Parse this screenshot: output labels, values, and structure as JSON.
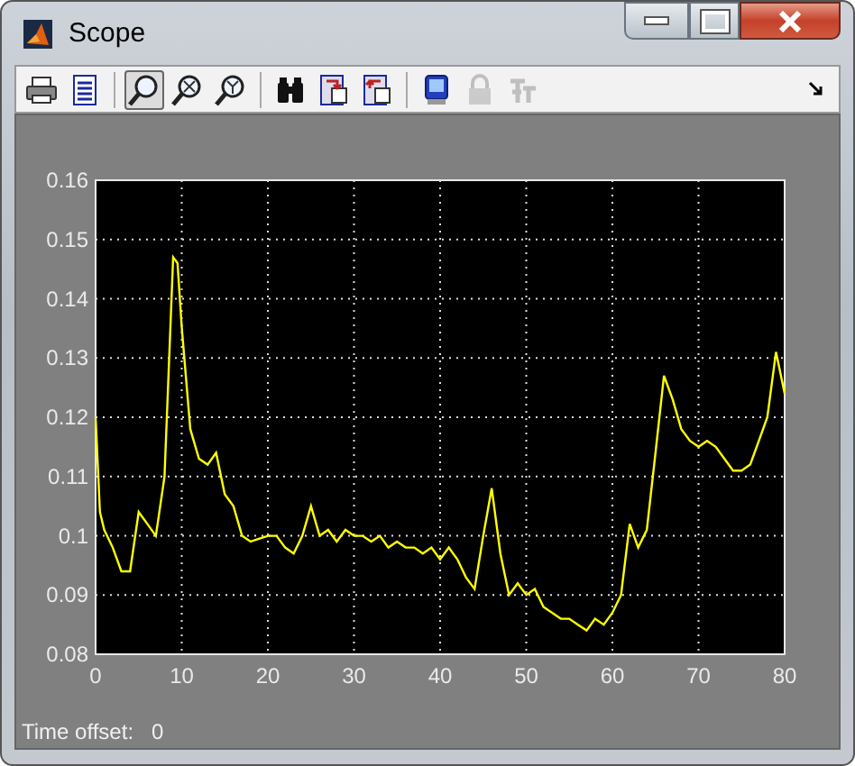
{
  "window": {
    "title": "Scope"
  },
  "toolbar": {
    "groups": [
      [
        {
          "kind": "print",
          "selected": false,
          "disabled": false
        },
        {
          "kind": "parameters",
          "selected": false,
          "disabled": false
        }
      ],
      [
        {
          "kind": "zoom",
          "selected": true,
          "disabled": false
        },
        {
          "kind": "zoom-x",
          "selected": false,
          "disabled": false
        },
        {
          "kind": "zoom-y",
          "selected": false,
          "disabled": false
        }
      ],
      [
        {
          "kind": "autoscale",
          "selected": false,
          "disabled": false
        },
        {
          "kind": "save-axes",
          "selected": false,
          "disabled": false
        },
        {
          "kind": "restore-axes",
          "selected": false,
          "disabled": false
        }
      ],
      [
        {
          "kind": "floating",
          "selected": false,
          "disabled": false
        },
        {
          "kind": "lock",
          "selected": false,
          "disabled": true
        },
        {
          "kind": "signal-selection",
          "selected": false,
          "disabled": true
        }
      ]
    ]
  },
  "scope": {
    "chart_data": {
      "type": "line",
      "x": [
        0,
        0.5,
        1,
        2,
        3,
        4,
        5,
        6,
        7,
        8,
        9,
        9.5,
        10,
        11,
        12,
        13,
        14,
        15,
        16,
        17,
        18,
        20,
        21,
        22,
        23,
        24,
        25,
        26,
        27,
        28,
        29,
        30,
        31,
        32,
        33,
        34,
        35,
        36,
        37,
        38,
        39,
        40,
        41,
        42,
        43,
        44,
        45,
        46,
        47,
        48,
        49,
        50,
        51,
        52,
        53,
        54,
        55,
        56,
        57,
        58,
        59,
        60,
        61,
        62,
        63,
        64,
        65,
        66,
        67,
        68,
        69,
        70,
        71,
        72,
        73,
        74,
        75,
        76,
        77,
        78,
        79,
        80
      ],
      "series": [
        {
          "color": "#ffff00",
          "values": [
            0.12,
            0.104,
            0.101,
            0.098,
            0.094,
            0.094,
            0.104,
            0.102,
            0.1,
            0.11,
            0.147,
            0.146,
            0.135,
            0.118,
            0.113,
            0.112,
            0.114,
            0.107,
            0.105,
            0.1,
            0.099,
            0.1,
            0.1,
            0.098,
            0.097,
            0.1,
            0.105,
            0.1,
            0.101,
            0.099,
            0.101,
            0.1,
            0.1,
            0.099,
            0.1,
            0.098,
            0.099,
            0.098,
            0.098,
            0.097,
            0.098,
            0.096,
            0.098,
            0.096,
            0.093,
            0.091,
            0.1,
            0.108,
            0.097,
            0.09,
            0.092,
            0.09,
            0.091,
            0.088,
            0.087,
            0.086,
            0.086,
            0.085,
            0.084,
            0.086,
            0.085,
            0.087,
            0.09,
            0.102,
            0.098,
            0.101,
            0.114,
            0.127,
            0.123,
            0.118,
            0.116,
            0.115,
            0.116,
            0.115,
            0.113,
            0.111,
            0.111,
            0.112,
            0.116,
            0.12,
            0.131,
            0.124
          ]
        }
      ],
      "grid": true,
      "xlim": [
        0,
        80
      ],
      "ylim": [
        0.08,
        0.16
      ],
      "xticks": [
        0,
        10,
        20,
        30,
        40,
        50,
        60,
        70,
        80
      ],
      "yticks": [
        {
          "value": 0.08,
          "label": "0.08"
        },
        {
          "value": 0.09,
          "label": "0.09"
        },
        {
          "value": 0.1,
          "label": "0.1"
        },
        {
          "value": 0.11,
          "label": "0.11"
        },
        {
          "value": 0.12,
          "label": "0.12"
        },
        {
          "value": 0.13,
          "label": "0.13"
        },
        {
          "value": 0.14,
          "label": "0.14"
        },
        {
          "value": 0.15,
          "label": "0.15"
        },
        {
          "value": 0.16,
          "label": "0.16"
        }
      ]
    }
  },
  "status": {
    "label": "Time offset:",
    "value": "0"
  }
}
